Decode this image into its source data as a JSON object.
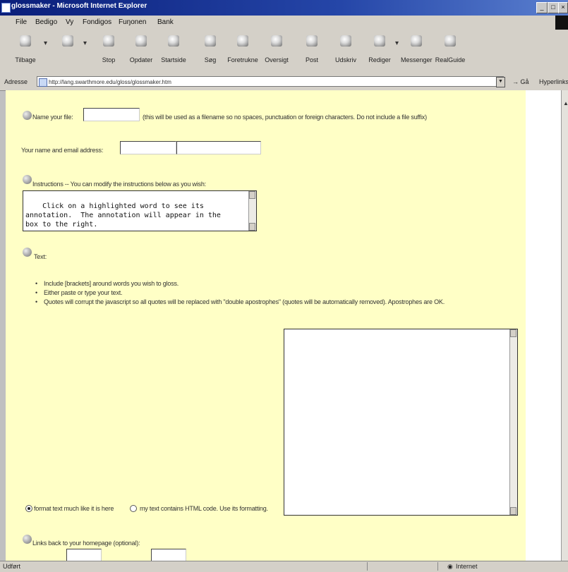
{
  "window": {
    "title": "glossmaker - Microsoft Internet Explorer"
  },
  "menu": [
    "File",
    "Bedigo",
    "Vy",
    "Fondigos",
    "Fuŋonen",
    "Bank"
  ],
  "toolbar": {
    "buttons": [
      {
        "label": "Tilbage",
        "icon": "back-icon"
      },
      {
        "label": "",
        "icon": "forward-icon"
      },
      {
        "label": "Stop",
        "icon": "stop-icon"
      },
      {
        "label": "Opdater",
        "icon": "refresh-icon"
      },
      {
        "label": "Startside",
        "icon": "home-icon"
      },
      {
        "label": "Søg",
        "icon": "search-icon"
      },
      {
        "label": "Foretrukne",
        "icon": "favorites-icon"
      },
      {
        "label": "Oversigt",
        "icon": "history-icon"
      },
      {
        "label": "Post",
        "icon": "mail-icon"
      },
      {
        "label": "Udskriv",
        "icon": "print-icon"
      },
      {
        "label": "Rediger",
        "icon": "edit-icon"
      },
      {
        "label": "Messenger",
        "icon": "messenger-icon"
      },
      {
        "label": "RealGuide",
        "icon": "realguide-icon"
      }
    ]
  },
  "address": {
    "label": "Adresse",
    "url": "http://lang.swarthmore.edu/gloss/glossmaker.htm",
    "go": "Gå",
    "links": "Hyperlinks"
  },
  "form": {
    "filename_label": "Name your file:",
    "filename_value": "",
    "filename_note": "(this will be used as a filename so no spaces, punctuation or foreign characters. Do not include a file suffix)",
    "name_email_label": "Your name and email address:",
    "name_value": "",
    "email_value": "",
    "instructions_label": "Instructions -- You can modify the instructions below as you wish:",
    "instructions_text": "Click on a highlighted word to see its\nannotation.  The annotation will appear in the\nbox to the right.",
    "text_label": "Text:",
    "text_bullets": [
      "Include [brackets] around words you wish to gloss.",
      "Either paste or type your text.",
      "Quotes will corrupt the javascript so all quotes will be replaced with \"double apostrophes\" (quotes will be automatically removed). Apostrophes are OK."
    ],
    "text_value": "",
    "radio_plain_label": "format text much like it is here",
    "radio_html_label": "my text contains HTML code. Use its formatting.",
    "links_label": "Links back to your homepage (optional):"
  },
  "status": {
    "left": "Udført",
    "zone": "Internet"
  }
}
